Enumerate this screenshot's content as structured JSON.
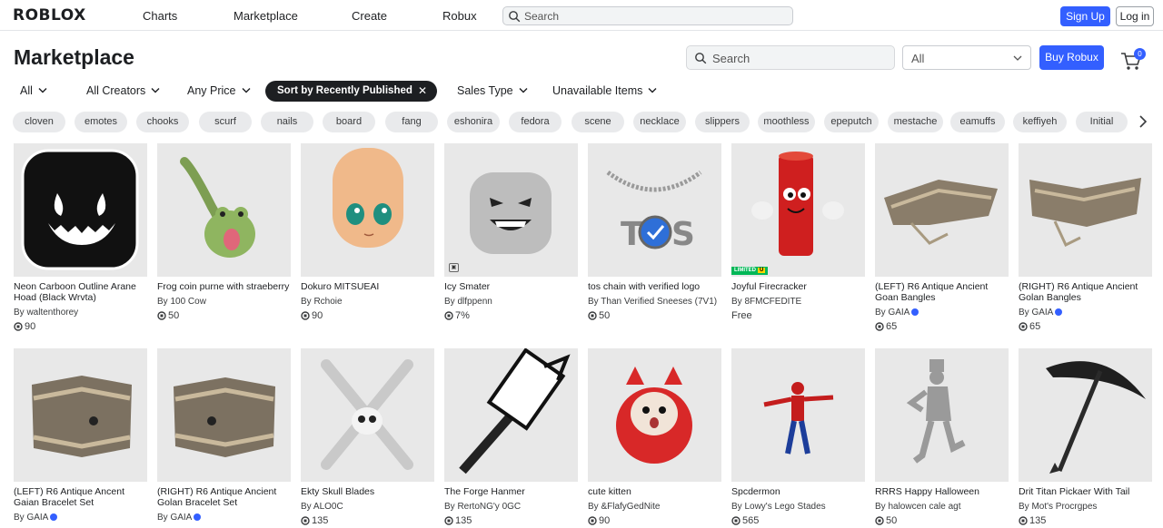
{
  "topnav": {
    "logo": "ROBLOX",
    "links": [
      "Charts",
      "Marketplace",
      "Create",
      "Robux"
    ],
    "search_placeholder": "Search",
    "signup": "Sign Up",
    "login": "Log in"
  },
  "header": {
    "title": "Marketplace",
    "search_placeholder": "Search",
    "category_select": "All",
    "buy_robux": "Buy Robux",
    "cart_count": "0"
  },
  "filters": {
    "category": "All",
    "creators": "All Creators",
    "price": "Any Price",
    "sort": "Sort by Recently Published",
    "sales_type": "Sales Type",
    "unavailable": "Unavailable Items"
  },
  "tags": [
    "cloven",
    "emotes",
    "chooks",
    "scurf",
    "nails",
    "board",
    "fang",
    "eshonira",
    "fedora",
    "scene",
    "necklace",
    "slippers",
    "moothless",
    "epeputch",
    "mestache",
    "eamuffs",
    "keffiyeh",
    "Initial"
  ],
  "items": [
    {
      "name": "Neon Carboon Outline Arane Hoad (Black Wrvta)",
      "by": "By waltenthorey",
      "price": "90",
      "verified": false
    },
    {
      "name": "Frog coin purne with straeberry",
      "by": "By 100 Cow",
      "price": "50",
      "verified": false
    },
    {
      "name": "Dokuro MITSUEAI",
      "by": "By Rchoie",
      "price": "90",
      "verified": false
    },
    {
      "name": "Icy Smater",
      "by": "By dlfppenn",
      "price": "7%",
      "verified": false
    },
    {
      "name": "tos chain with verified logo",
      "by": "By Than Verified Sneeses (7V1)",
      "price": "50",
      "verified": false
    },
    {
      "name": "Joyful Firecracker",
      "by": "By 8FMCFEDITE",
      "price": "Free",
      "verified": false,
      "limited": "LIMITED",
      "limited_suffix": "U"
    },
    {
      "name": "(LEFT) R6 Antique Ancient Goan Bangles",
      "by": "By GAIA",
      "price": "65",
      "verified": true
    },
    {
      "name": "(RIGHT) R6 Antique Ancient Golan Bangles",
      "by": "By GAIA",
      "price": "65",
      "verified": true
    },
    {
      "name": "(LEFT) R6 Antique Ancent Gaian Bracelet Set",
      "by": "By GAIA",
      "price": "",
      "verified": true
    },
    {
      "name": "(RIGHT) R6 Antique Ancient Golan Bracelet Set",
      "by": "By GAIA",
      "price": "",
      "verified": true
    },
    {
      "name": "Ekty Skull Blades",
      "by": "By ALO0C",
      "price": "135",
      "verified": false
    },
    {
      "name": "The Forge Hanmer",
      "by": "By RertoNG'y 0GC",
      "price": "135",
      "verified": false
    },
    {
      "name": "cute kitten",
      "by": "By &FlafyGedNite",
      "price": "90",
      "verified": false
    },
    {
      "name": "Spcdermon",
      "by": "By Lowy's Lego Stades",
      "price": "565",
      "verified": false
    },
    {
      "name": "RRRS Happy Halloween",
      "by": "By halowcen cale agt",
      "price": "50",
      "verified": false
    },
    {
      "name": "Drit Titan Pickaer With Tail",
      "by": "By Mot's Procrgpes",
      "price": "135",
      "verified": false
    }
  ],
  "colors": {
    "accent": "#335fff",
    "chip": "#e9eaec",
    "thumb_bg": "#e8e8e8",
    "limited": "#02b757"
  }
}
